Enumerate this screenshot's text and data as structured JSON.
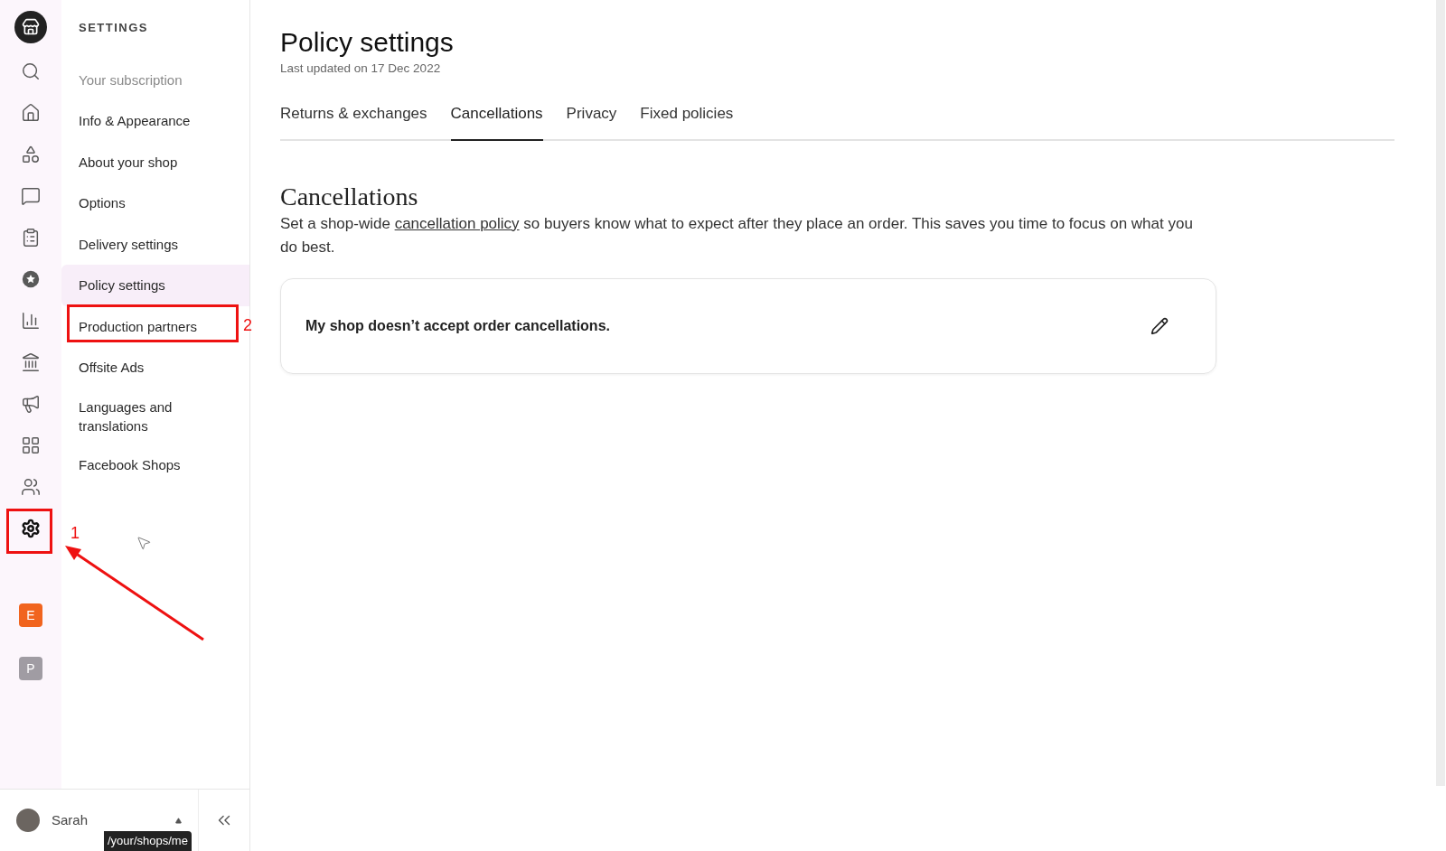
{
  "rail": {
    "items": [
      {
        "kind": "search",
        "selected": false
      },
      {
        "kind": "home",
        "selected": false
      },
      {
        "kind": "shapes",
        "selected": false
      },
      {
        "kind": "messages",
        "selected": false
      },
      {
        "kind": "orders",
        "selected": false
      },
      {
        "kind": "star",
        "selected": false
      },
      {
        "kind": "stats",
        "selected": false
      },
      {
        "kind": "bank",
        "selected": false
      },
      {
        "kind": "marketing",
        "selected": false
      },
      {
        "kind": "apps",
        "selected": false
      },
      {
        "kind": "community",
        "selected": false
      },
      {
        "kind": "settings",
        "selected": true
      }
    ],
    "shops": [
      {
        "letter": "E",
        "color": "#f1641e"
      },
      {
        "letter": "P",
        "color": "#a09ca3"
      }
    ]
  },
  "settings_nav": {
    "heading": "SETTINGS",
    "items": [
      {
        "label": "Your subscription",
        "selected": false,
        "disabled": true
      },
      {
        "label": "Info & Appearance",
        "selected": false,
        "disabled": false
      },
      {
        "label": "About your shop",
        "selected": false,
        "disabled": false
      },
      {
        "label": "Options",
        "selected": false,
        "disabled": false
      },
      {
        "label": "Delivery settings",
        "selected": false,
        "disabled": false
      },
      {
        "label": "Policy settings",
        "selected": true,
        "disabled": false
      },
      {
        "label": "Production partners",
        "selected": false,
        "disabled": false
      },
      {
        "label": "Offsite Ads",
        "selected": false,
        "disabled": false
      },
      {
        "label": "Languages and translations",
        "selected": false,
        "disabled": false
      },
      {
        "label": "Facebook Shops",
        "selected": false,
        "disabled": false
      }
    ]
  },
  "user": {
    "name": "Sarah"
  },
  "status_url": "/your/shops/me",
  "page": {
    "title": "Policy settings",
    "subtitle": "Last updated on 17 Dec 2022",
    "tabs": [
      {
        "label": "Returns & exchanges",
        "selected": false
      },
      {
        "label": "Cancellations",
        "selected": true
      },
      {
        "label": "Privacy",
        "selected": false
      },
      {
        "label": "Fixed policies",
        "selected": false
      }
    ],
    "section": {
      "title": "Cancellations",
      "text_before": "Set a shop-wide ",
      "link": "cancellation policy",
      "text_after": " so buyers know what to expect after they place an order. This saves you time to focus on what you do best.",
      "policy": "My shop doesn’t accept order cancellations."
    }
  },
  "annotations": [
    "1",
    "2"
  ]
}
